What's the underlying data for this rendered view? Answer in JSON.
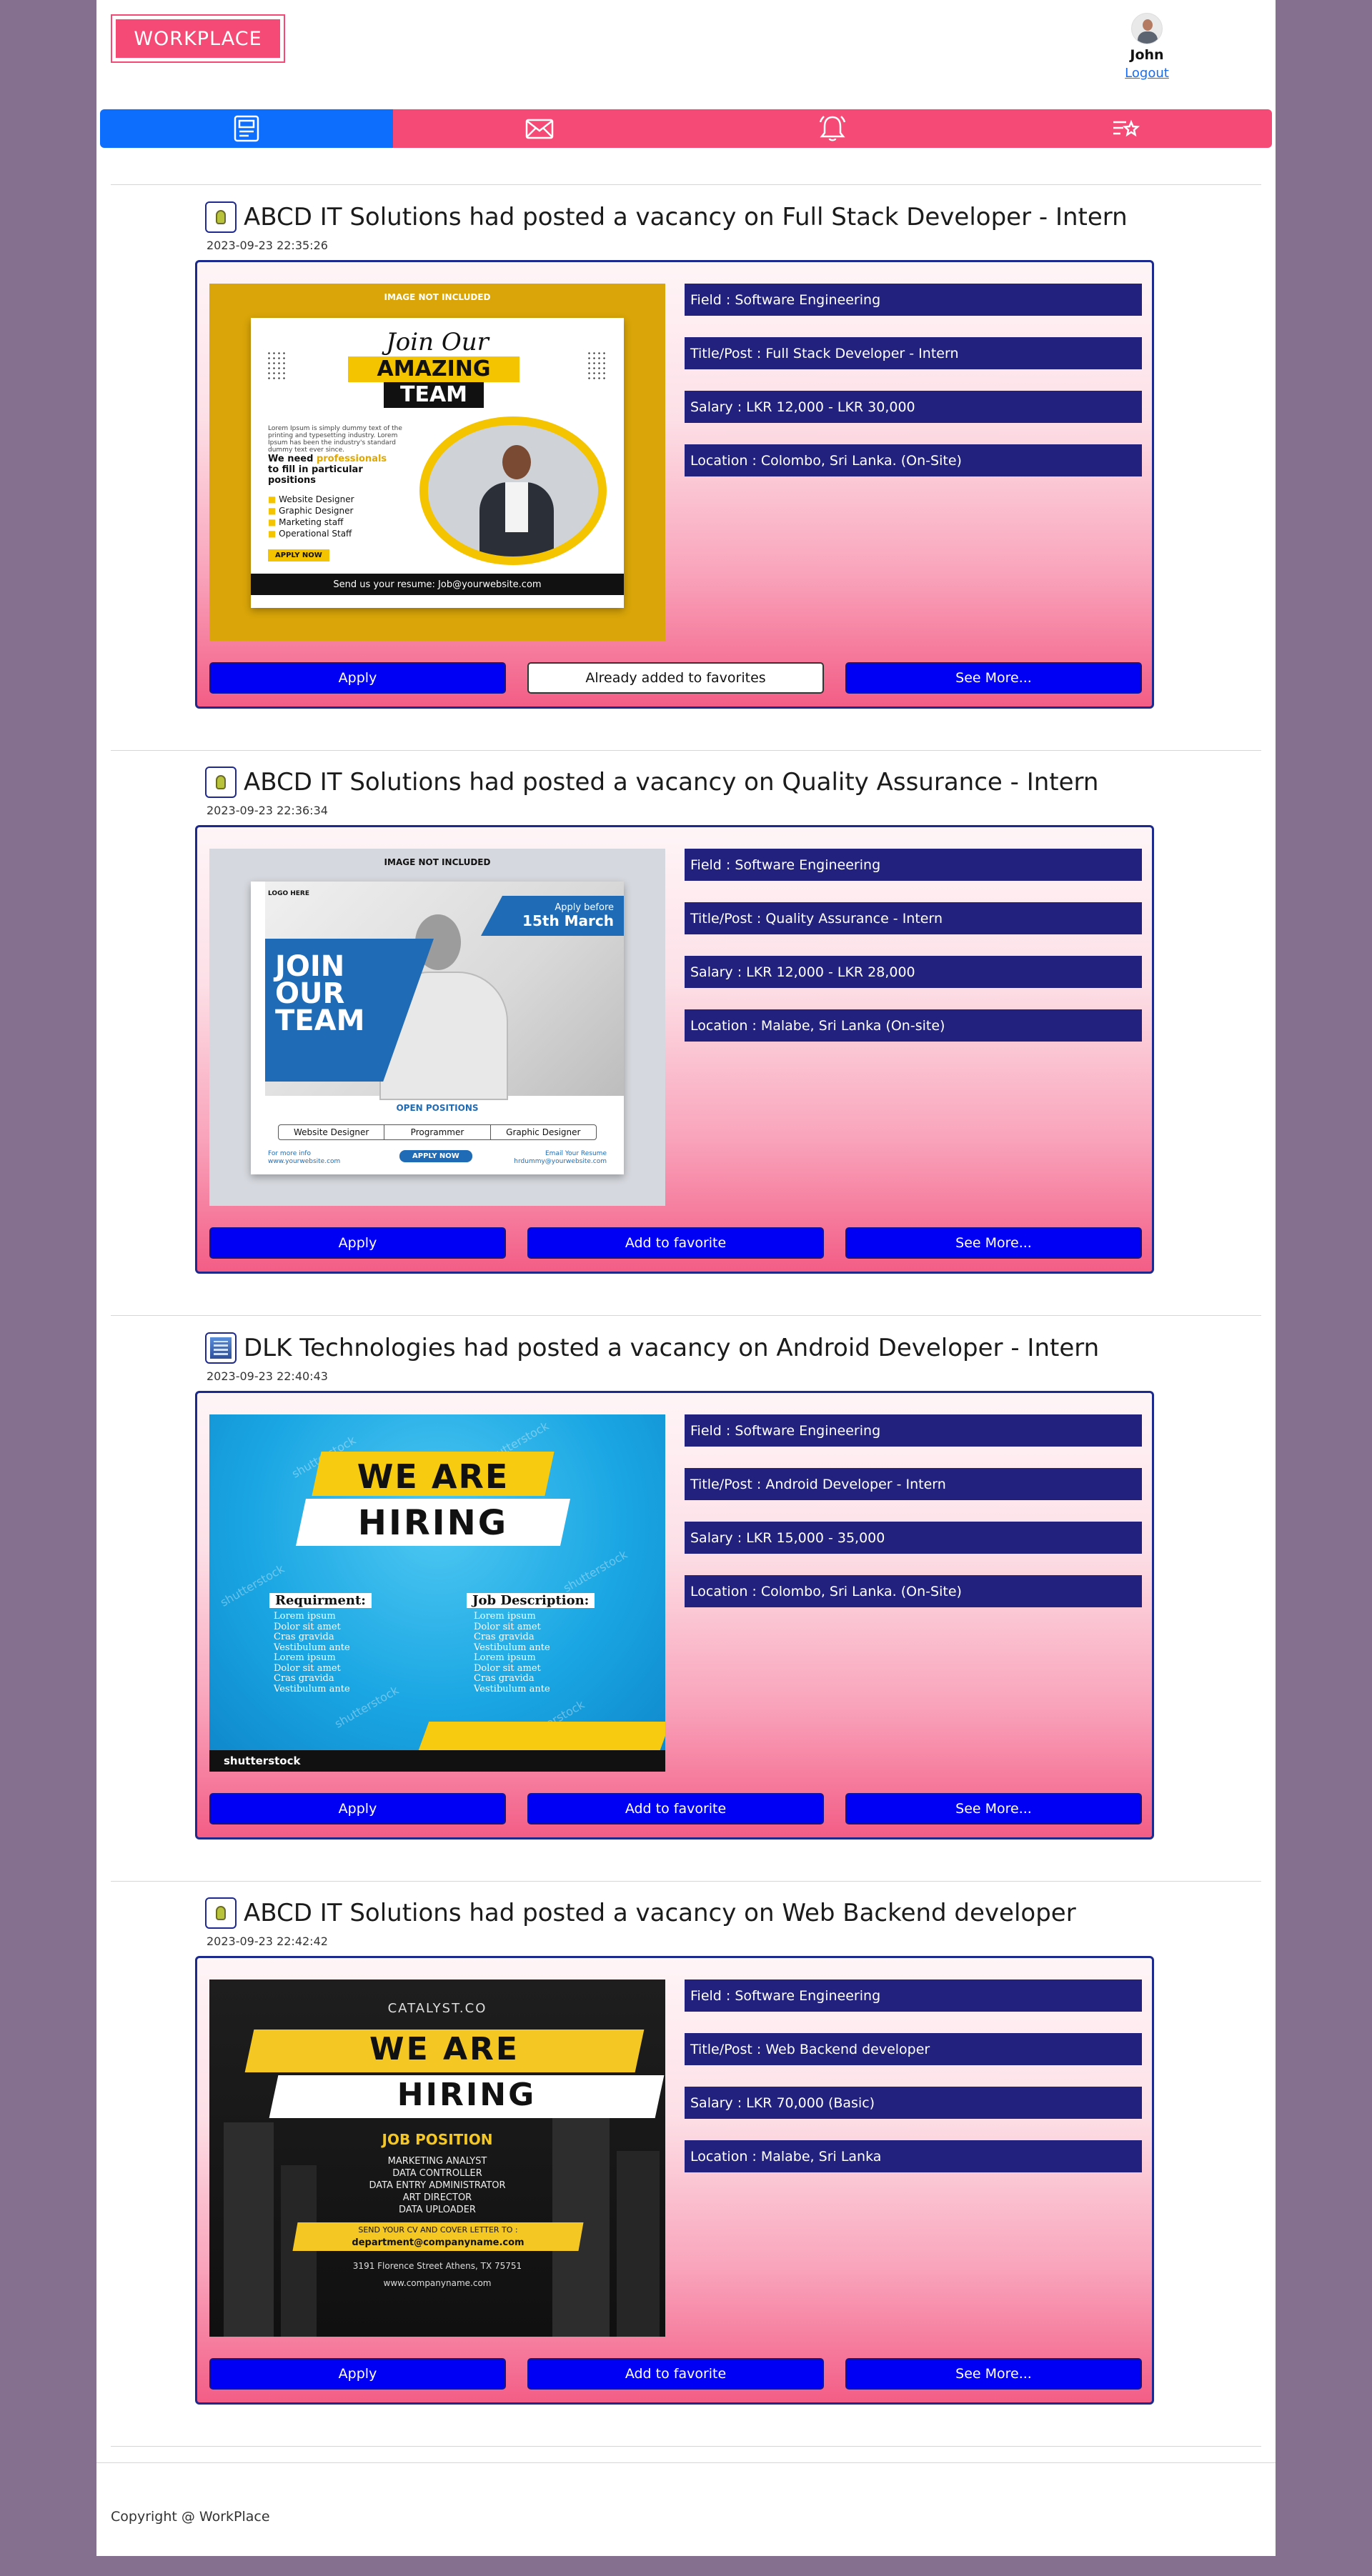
{
  "header": {
    "logo_part1": "WORK",
    "logo_part2": "PLACE",
    "user_name": "John",
    "logout_label": "Logout"
  },
  "nav": [
    {
      "icon": "posts-icon",
      "active": true
    },
    {
      "icon": "mail-icon",
      "active": false
    },
    {
      "icon": "bell-icon",
      "active": false
    },
    {
      "icon": "favorites-list-icon",
      "active": false
    }
  ],
  "posts": [
    {
      "company_icon": "bulb-logo-icon",
      "title": "ABCD IT Solutions had posted a vacancy on Full Stack Developer - Intern",
      "date": "2023-09-23 22:35:26",
      "field": "Field : Software Engineering",
      "post": "Title/Post : Full Stack Developer - Intern",
      "salary": "Salary : LKR 12,000 - LKR 30,000",
      "location": "Location : Colombo, Sri Lanka. (On-Site)",
      "apply_label": "Apply",
      "fav_label": "Already added to favorites",
      "more_label": "See More...",
      "poster": {
        "note": "IMAGE NOT INCLUDED",
        "join": "Join Our",
        "amazing": "AMAZING",
        "team": "TEAM",
        "lorem": "Lorem Ipsum is simply dummy text of the printing and typesetting industry. Lorem Ipsum has been the industry's standard dummy text ever since.",
        "need1": "We need",
        "need_highlight": "professionals",
        "need2": "to fill in particular",
        "need3": "positions",
        "roles": [
          "Website Designer",
          "Graphic Designer",
          "Marketing staff",
          "Operational Staff"
        ],
        "apply_now": "APPLY NOW",
        "send": "Send us your resume: Job@yourwebsite.com"
      }
    },
    {
      "company_icon": "bulb-logo-icon",
      "title": "ABCD IT Solutions had posted a vacancy on Quality Assurance - Intern",
      "date": "2023-09-23 22:36:34",
      "field": "Field : Software Engineering",
      "post": "Title/Post : Quality Assurance - Intern",
      "salary": "Salary : LKR 12,000 - LKR 28,000",
      "location": "Location : Malabe, Sri Lanka (On-site)",
      "apply_label": "Apply",
      "fav_label": "Add to favorite",
      "more_label": "See More...",
      "poster": {
        "note": "IMAGE NOT INCLUDED",
        "logo_here": "LOGO HERE",
        "apply_before": "Apply before",
        "deadline": "15th March",
        "join": "JOIN OUR TEAM",
        "open": "OPEN POSITIONS",
        "roles": [
          "Website Designer",
          "Programmer",
          "Graphic Designer"
        ],
        "apply_now": "APPLY NOW",
        "more_info": "For more info www.yourwebsite.com",
        "email": "Email Your Resume hrdummy@yourwebsite.com"
      }
    },
    {
      "company_icon": "building-logo-icon",
      "title": "DLK Technologies had posted a vacancy on Android Developer - Intern",
      "date": "2023-09-23 22:40:43",
      "field": "Field : Software Engineering",
      "post": "Title/Post : Android Developer - Intern",
      "salary": "Salary : LKR 15,000 - 35,000",
      "location": "Location : Colombo, Sri Lanka. (On-Site)",
      "apply_label": "Apply",
      "fav_label": "Add to favorite",
      "more_label": "See More...",
      "poster": {
        "we_are": "WE ARE",
        "hiring": "HIRING",
        "req_label": "Requirment:",
        "desc_label": "Job Description:",
        "items": [
          "Lorem ipsum",
          "Dolor sit amet",
          "Cras gravida",
          "Vestibulum ante",
          "Lorem ipsum",
          "Dolor sit amet",
          "Cras gravida",
          "Vestibulum ante"
        ],
        "watermark": "shutterstock",
        "brand": "shutterstock"
      }
    },
    {
      "company_icon": "bulb-logo-icon",
      "title": "ABCD IT Solutions had posted a vacancy on Web Backend developer",
      "date": "2023-09-23 22:42:42",
      "field": "Field : Software Engineering",
      "post": "Title/Post : Web Backend developer",
      "salary": "Salary : LKR 70,000 (Basic)",
      "location": "Location : Malabe, Sri Lanka",
      "apply_label": "Apply",
      "fav_label": "Add to favorite",
      "more_label": "See More...",
      "poster": {
        "catalyst": "CATALYST.CO",
        "we_are": "WE ARE",
        "hiring": "HIRING",
        "job_position": "JOB POSITION",
        "roles": [
          "MARKETING ANALYST",
          "DATA CONTROLLER",
          "DATA ENTRY ADMINISTRATOR",
          "ART DIRECTOR",
          "DATA UPLOADER"
        ],
        "send": "SEND YOUR CV AND COVER LETTER TO :",
        "email": "department@companyname.com",
        "address": "3191 Florence Street Athens, TX 75751",
        "website": "www.companyname.com"
      }
    }
  ],
  "footer": {
    "copyright": "Copyright @ WorkPlace"
  }
}
